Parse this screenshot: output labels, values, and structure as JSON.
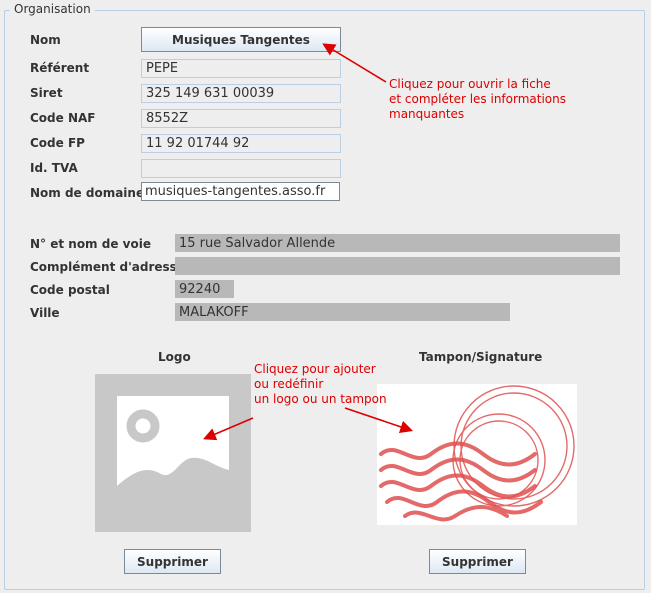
{
  "panel": {
    "title": "Organisation"
  },
  "nom": {
    "label": "Nom",
    "button_label": "Musiques Tangentes"
  },
  "fields": [
    {
      "label": "Référent",
      "value": "PEPE"
    },
    {
      "label": "Siret",
      "value": "325 149 631 00039"
    },
    {
      "label": "Code NAF",
      "value": "8552Z"
    },
    {
      "label": "Code FP",
      "value": "11 92 01744 92"
    },
    {
      "label": "Id. TVA",
      "value": ""
    },
    {
      "label": "Nom de domaine",
      "value": "musiques-tangentes.asso.fr"
    }
  ],
  "address": [
    {
      "label": "N° et nom de voie",
      "value": "15 rue Salvador Allende"
    },
    {
      "label": "Complément d'adresse",
      "value": ""
    },
    {
      "label": "Code postal",
      "value": "92240"
    },
    {
      "label": "Ville",
      "value": "MALAKOFF"
    }
  ],
  "annotations": {
    "fiche": "Cliquez pour ouvrir la fiche\net compléter les informations\nmanquantes",
    "logo": "Cliquez pour ajouter\nou redéfinir\nun logo ou un tampon"
  },
  "logo": {
    "title": "Logo",
    "delete_label": "Supprimer"
  },
  "stamp": {
    "title": "Tampon/Signature",
    "delete_label": "Supprimer"
  },
  "colors": {
    "annotation": "#dd0000",
    "placeholder": "#c8c8c8",
    "stamp": "#e05050"
  }
}
